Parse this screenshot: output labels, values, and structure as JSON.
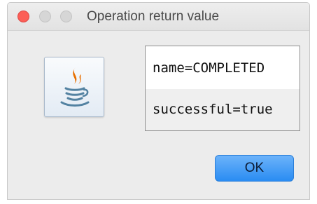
{
  "window": {
    "title": "Operation return value"
  },
  "icon": {
    "name": "java-icon"
  },
  "values": [
    {
      "text": "name=COMPLETED"
    },
    {
      "text": "successful=true"
    }
  ],
  "buttons": {
    "ok_label": "OK"
  },
  "colors": {
    "close": "#fc5f57",
    "inactive_traffic": "#d6d6d6",
    "ok_button": "#2a8cf2",
    "java_orange": "#e76f00",
    "java_blue": "#5382a1"
  }
}
